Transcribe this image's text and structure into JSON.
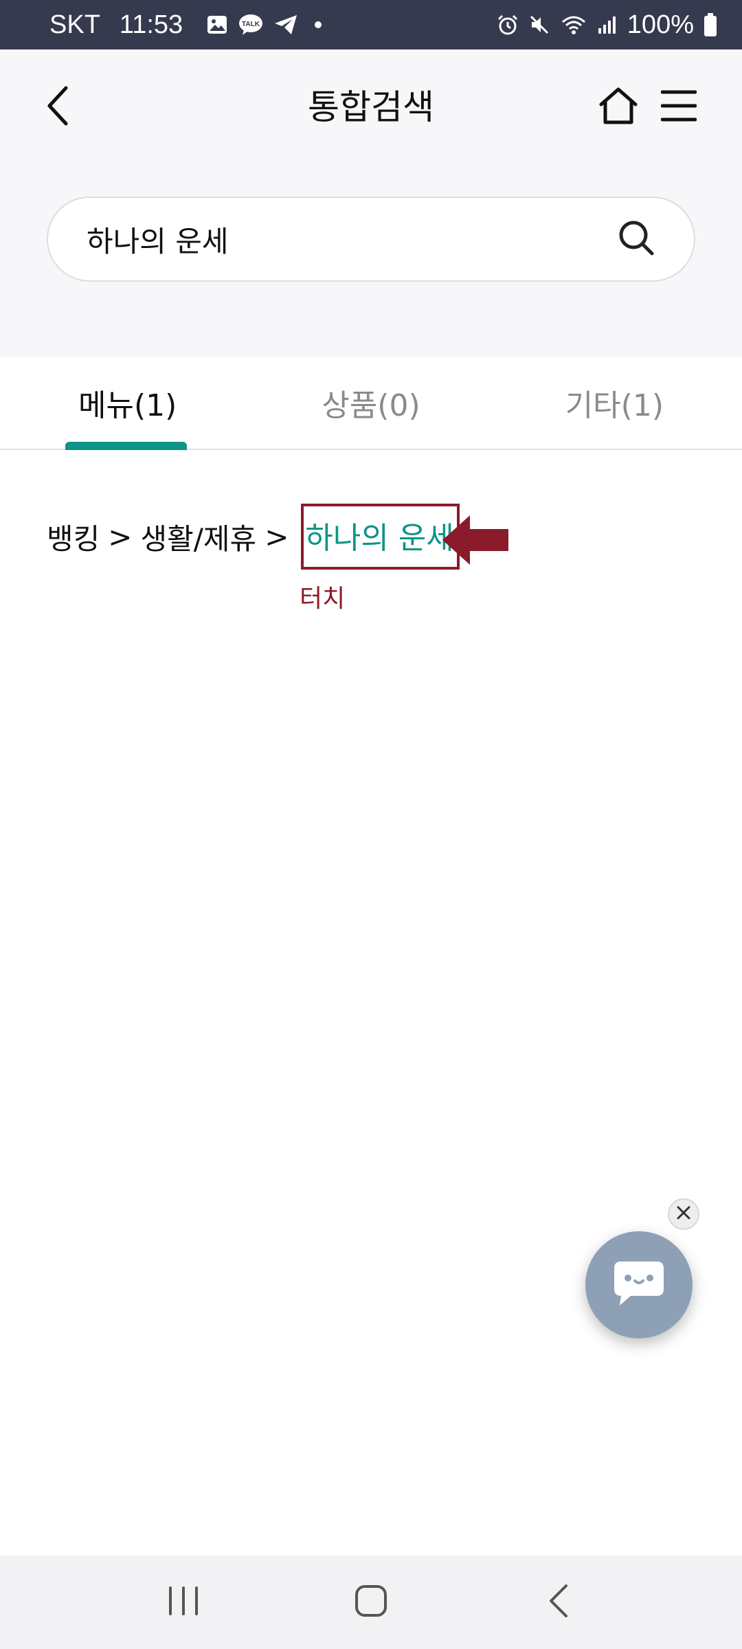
{
  "status_bar": {
    "carrier": "SKT",
    "time": "11:53",
    "battery": "100%",
    "icons": [
      "gallery-icon",
      "talk-icon",
      "telegram-icon",
      "dot-icon",
      "alarm-icon",
      "mute-icon",
      "wifi-icon",
      "signal-icon",
      "battery-icon"
    ]
  },
  "header": {
    "title": "통합검색",
    "back_icon": "chevron-left-icon",
    "home_icon": "home-icon",
    "menu_icon": "hamburger-menu-icon"
  },
  "search": {
    "value": "하나의 운세",
    "placeholder": ""
  },
  "tabs": [
    {
      "label": "메뉴(1)",
      "active": true
    },
    {
      "label": "상품(0)",
      "active": false
    },
    {
      "label": "기타(1)",
      "active": false
    }
  ],
  "result": {
    "crumb1": "뱅킹",
    "crumb2": "생활/제휴",
    "separator": ">",
    "link": "하나의 운세"
  },
  "annotation": {
    "label": "터치",
    "color": "#8b1a2a"
  },
  "colors": {
    "accent": "#0e9488",
    "status_bar": "#363a4e",
    "chat_fab": "#8ea0b5"
  },
  "chatbot": {
    "icon": "chatbot-icon",
    "close_icon": "close-icon"
  },
  "nav": {
    "recent_icon": "recent-apps-icon",
    "home_icon": "home-square-icon",
    "back_icon": "back-chevron-icon"
  }
}
